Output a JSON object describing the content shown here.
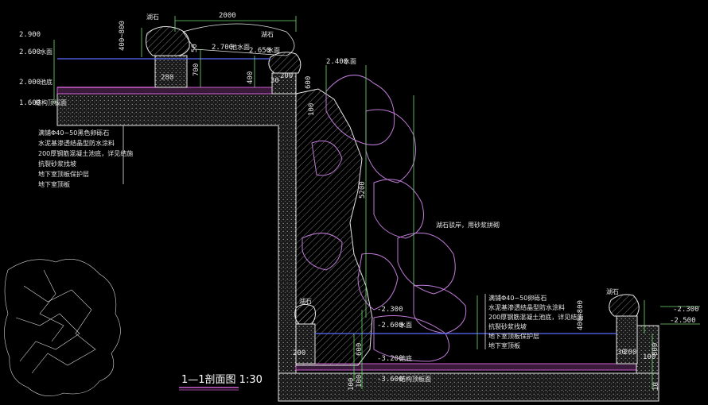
{
  "colors": {
    "background": "#000000",
    "outline": "#e6e6e6",
    "dimension": "#6fdc6f",
    "rock": "#c07ad8",
    "water_surface": "#5a6cff",
    "title_underline": "#d060d0"
  },
  "title": "1—1剖面图 1:30",
  "dims": {
    "top_width": "2000",
    "rock_height_top": "400~800",
    "d50": "50",
    "d700": "700",
    "d400": "400",
    "d280": "280",
    "d30": "30",
    "d200_a": "200",
    "d300": "300",
    "d600_top": "600",
    "d100_top": "100",
    "d5200": "5200",
    "d400_800_right": "400~800",
    "d600_mid": "600",
    "d100_mid": "100",
    "d200_bl": "200",
    "d100_bl": "100",
    "d200_right": "200",
    "d300_right": "30",
    "d100_right": "100",
    "d800_right": "800",
    "d10": "10"
  },
  "elevations": {
    "e2900": "2.900",
    "e2600": "2.600",
    "e2000": "2.000",
    "e1600": "1.600",
    "e2700": "2.700",
    "e2650": "2.650",
    "e2400": "2.400",
    "e_m2300": "-2.300",
    "e_m2600": "-2.600",
    "e_m3200": "-3.200",
    "e_m3600": "-3.600",
    "e_m2300_r": "-2.300",
    "e_m2500_r": "-2.500"
  },
  "labels": {
    "rock_top_left": "湖石",
    "rock_top_right": "湖石",
    "rock_bottom_left": "湖石",
    "rock_bottom_right": "湖石",
    "pool_water": "池水面",
    "water_level": "水面",
    "pool_bottom": "池底",
    "structure_top": "结构顶板面",
    "rock_face": "湖石驳岸，用砂浆拼砌",
    "lbl_2700": "池水面",
    "lbl_2650": "水面",
    "lbl_2400": "水面",
    "lbl_m2600": "水面",
    "lbl_m3200": "池底",
    "lbl_m3600": "结构顶板面",
    "lbl_m2500": "水面",
    "lbl_2600": "水面",
    "lbl_2000": "池底",
    "lbl_1600": "结构顶板面"
  },
  "notes_left": [
    "满铺Φ40~50黑色卵砾石",
    "水泥基渗透结晶型防水涂料",
    "200厚钢筋混凝土池底，详见结施",
    "抗裂砂浆找坡",
    "地下室顶板保护层",
    "地下室顶板"
  ],
  "notes_right": [
    "满铺Φ40~50卵砾石",
    "水泥基渗透结晶型防水涂料",
    "200厚钢筋混凝土池底，详见结施",
    "抗裂砂浆找坡",
    "地下室顶板保护层",
    "地下室顶板"
  ]
}
